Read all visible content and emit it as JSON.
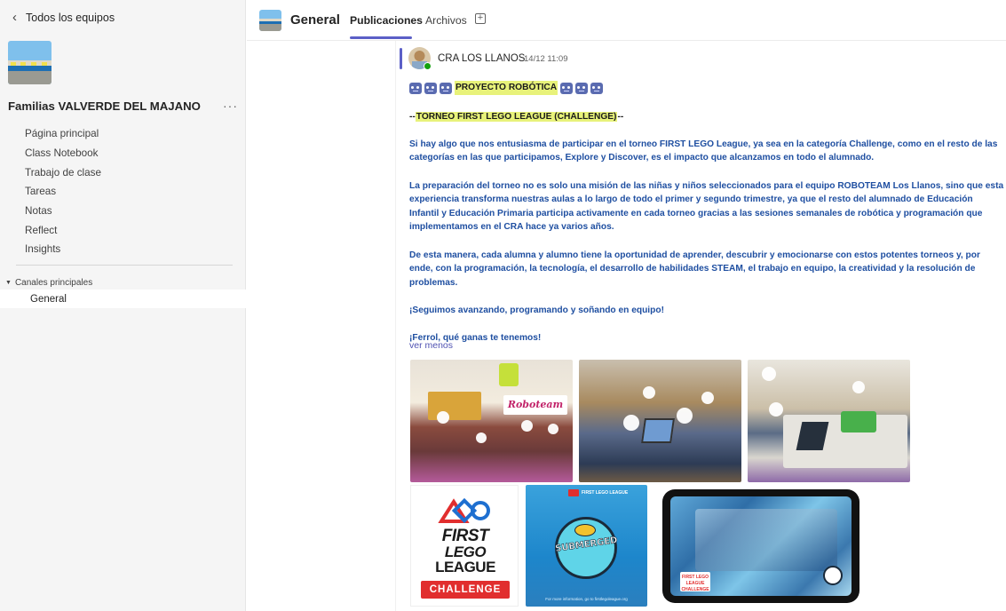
{
  "sidebar": {
    "back_label": "Todos los equipos",
    "team_name": "Familias VALVERDE DEL MAJANO",
    "more_label": "···",
    "nav_items": [
      {
        "label": "Página principal"
      },
      {
        "label": "Class Notebook"
      },
      {
        "label": "Trabajo de clase"
      },
      {
        "label": "Tareas"
      },
      {
        "label": "Notas"
      },
      {
        "label": "Reflect"
      },
      {
        "label": "Insights"
      }
    ],
    "channels_header": "Canales principales",
    "channels": [
      {
        "label": "General"
      }
    ]
  },
  "header": {
    "channel_title": "General",
    "tabs": [
      {
        "label": "Publicaciones",
        "active": true
      },
      {
        "label": "Archivos",
        "active": false
      }
    ],
    "add_tab_icon": "+"
  },
  "post": {
    "author": "CRA LOS LLANOS",
    "timestamp": "14/12 11:09",
    "title": "PROYECTO ROBÓTICA",
    "subtitle_prefix": "--",
    "subtitle": "TORNEO FIRST LEGO LEAGUE (CHALLENGE)",
    "subtitle_suffix": "--",
    "paragraphs": [
      "Si hay algo que nos entusiasma de participar en el torneo FIRST LEGO League, ya sea en la categoría Challenge, como en el resto de las categorías en las que participamos, Explore y Discover, es el impacto que alcanzamos en todo el alumnado.",
      "La preparación del torneo no es solo una misión de las niñas y niños seleccionados para el equipo ROBOTEAM Los Llanos, sino que esta experiencia transforma nuestras aulas a lo largo de todo el primer y segundo trimestre, ya que el resto del alumnado de Educación Infantil y Educación Primaria participa activamente en cada torneo gracias a las sesiones semanales de robótica y programación que implementamos en el CRA hace ya varios años.",
      "De esta manera, cada alumna y alumno tiene la oportunidad de aprender, descubrir y emocionarse con estos potentes torneos y, por ende, con la programación, la tecnología, el desarrollo de habilidades STEAM, el trabajo en equipo, la creatividad y la resolución de problemas."
    ],
    "closing_1": "¡Seguimos avanzando, programando y soñando en equipo!",
    "closing_2": "¡Ferrol, qué ganas te tenemos!",
    "toggle_label": "ver menos",
    "fll_logo": {
      "first": "FIRST",
      "lego": "LEGO",
      "league": "LEAGUE",
      "badge": "CHALLENGE"
    },
    "submerged_logo": {
      "word": "SUBMERGED",
      "top_text": "FIRST LEGO LEAGUE",
      "footer": "For more information, go to firstlegoleague.org"
    },
    "game_label": "FIRST LEGO LEAGUE CHALLENGE"
  },
  "colors": {
    "accent": "#5b5fc7",
    "body_text": "#1f4fa1",
    "highlight": "#e8f27a",
    "presence": "#13a10e"
  },
  "icons": {
    "back": "chevron-left-icon",
    "add_tab": "plus-square-icon",
    "collapse": "caret-down-icon",
    "robot": "robot-emoji-icon"
  }
}
